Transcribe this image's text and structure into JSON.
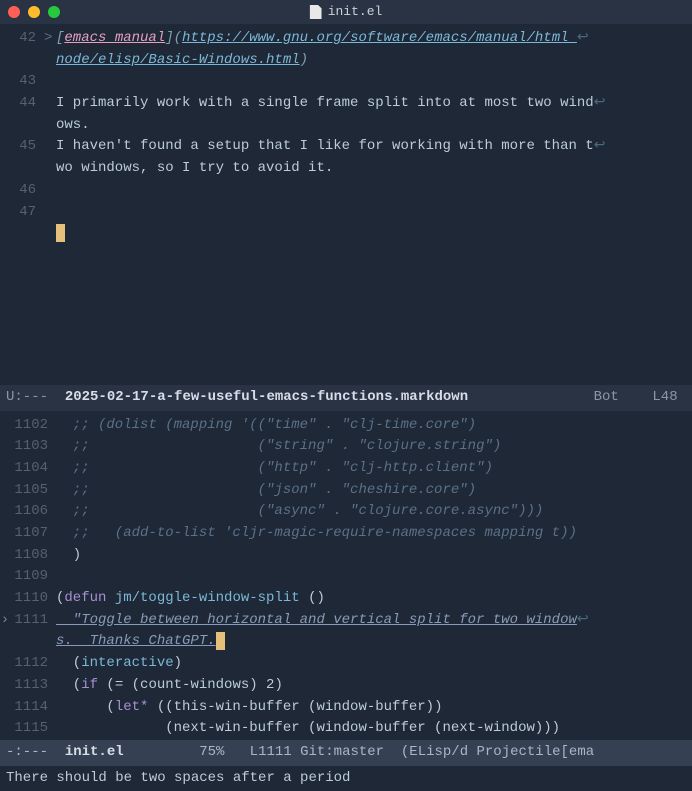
{
  "title": "init.el",
  "upper": {
    "lines": [
      {
        "num": "42",
        "fold": ">",
        "type": "quote"
      },
      {
        "num": "",
        "fold": "",
        "type": "quote2"
      },
      {
        "num": "43",
        "fold": "",
        "type": "blank"
      },
      {
        "num": "44",
        "fold": "",
        "type": "p44a"
      },
      {
        "num": "",
        "fold": "",
        "type": "p44b"
      },
      {
        "num": "45",
        "fold": "",
        "type": "p45a"
      },
      {
        "num": "",
        "fold": "",
        "type": "p45b"
      },
      {
        "num": "46",
        "fold": "",
        "type": "blank"
      },
      {
        "num": "47",
        "fold": "",
        "type": "blank"
      },
      {
        "num": "",
        "fold": "",
        "type": "cursor"
      }
    ],
    "quote_pre": "[",
    "quote_txt": "emacs manual",
    "quote_mid": "](",
    "quote_url1": "https://www.gnu.org/software/emacs/manual/html_",
    "quote_url2": "node/elisp/Basic-Windows.html",
    "quote_end": ")",
    "p44a": "I primarily work with a single frame split into at most two wind",
    "p44b": "ows.",
    "p45a": "I haven't found a setup that I like for working with more than t",
    "p45b": "wo windows, so I try to avoid it."
  },
  "modeline1": {
    "left": "U:--- ",
    "file": " 2025-02-17-a-few-useful-emacs-functions.markdown",
    "right": "   Bot    L48 "
  },
  "lower": {
    "l1102": {
      "num": "1102",
      "c": "  ;; (dolist (mapping '((\"time\" . \"clj-time.core\")"
    },
    "l1103": {
      "num": "1103",
      "c": "  ;;                    (\"string\" . \"clojure.string\")"
    },
    "l1104": {
      "num": "1104",
      "c": "  ;;                    (\"http\" . \"clj-http.client\")"
    },
    "l1105": {
      "num": "1105",
      "c": "  ;;                    (\"json\" . \"cheshire.core\")"
    },
    "l1106": {
      "num": "1106",
      "c": "  ;;                    (\"async\" . \"clojure.core.async\")))"
    },
    "l1107": {
      "num": "1107",
      "c": "  ;;   (add-to-list 'cljr-magic-require-namespaces mapping t))"
    },
    "l1108": {
      "num": "1108",
      "c": "  )"
    },
    "l1109": {
      "num": "1109",
      "c": ""
    },
    "l1110": {
      "num": "1110"
    },
    "defun_pre": "(",
    "defun_kw": "defun",
    "defun_name": " jm/toggle-window-split ",
    "defun_args": "()",
    "l1111": {
      "num": "1111"
    },
    "doc1": "  \"Toggle between horizontal and vertical split for two window",
    "doc2": "s.  Thanks ChatGPT.",
    "l1112": {
      "num": "1112"
    },
    "interactive": "  (interactive)",
    "l1113": {
      "num": "1113"
    },
    "if_line": "  (if (= (count-windows) 2)",
    "l1114": {
      "num": "1114"
    },
    "let_line": "      (let* ((this-win-buffer (window-buffer))",
    "l1115": {
      "num": "1115"
    },
    "next_line": "             (next-win-buffer (window-buffer (next-window)))"
  },
  "modeline2": {
    "left": "-:--- ",
    "file": " init.el",
    "mid": "         75%   L1111 Git:master  (ELisp/d Projectile[ema"
  },
  "echo": "There should be two spaces after a period"
}
